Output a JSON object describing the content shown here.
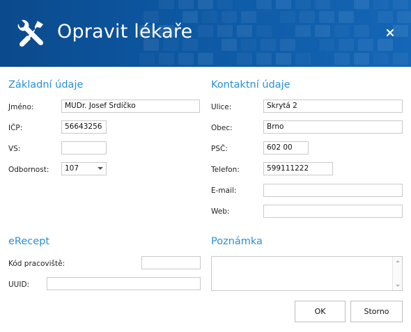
{
  "window": {
    "title": "Opravit lékaře",
    "app_icon": "tools-icon",
    "close_icon": "close-icon"
  },
  "colors": {
    "header_bg": "#0d58a3",
    "section_title": "#2a8fd6",
    "field_border": "#c9c9c9"
  },
  "basic": {
    "title": "Základní údaje",
    "fields": [
      {
        "label": "Jméno:",
        "value": "MUDr. Josef Srdíčko"
      },
      {
        "label": "IČP:",
        "value": "56643256"
      },
      {
        "label": "VS:",
        "value": ""
      },
      {
        "label": "Odbornost:",
        "value": "107",
        "icon": "chevron-down-icon"
      }
    ]
  },
  "contact": {
    "title": "Kontaktní údaje",
    "fields": [
      {
        "label": "Ulice:",
        "value": "Skrytá 2"
      },
      {
        "label": "Obec:",
        "value": "Brno"
      },
      {
        "label": "PSČ:",
        "value": "602 00"
      },
      {
        "label": "Telefon:",
        "value": "599111222"
      },
      {
        "label": "E-mail:",
        "value": ""
      },
      {
        "label": "Web:",
        "value": ""
      }
    ]
  },
  "erecept": {
    "title": "eRecept",
    "fields": [
      {
        "label": "Kód pracoviště:",
        "value": ""
      },
      {
        "label": "UUID:",
        "value": ""
      }
    ]
  },
  "note": {
    "title": "Poznámka",
    "value": ""
  },
  "buttons": {
    "ok": "OK",
    "cancel": "Storno"
  }
}
